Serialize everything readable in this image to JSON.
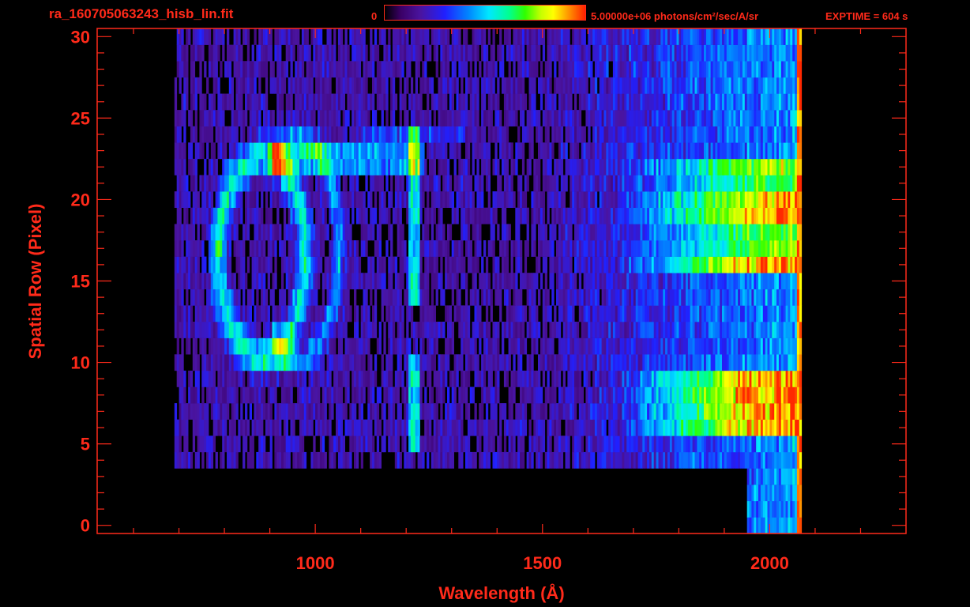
{
  "chart_data": {
    "type": "heatmap",
    "title": "ra_160705063243_hisb_lin.fit",
    "xlabel": "Wavelength (Å)",
    "ylabel": "Spatial Row (Pixel)",
    "xlim": [
      520,
      2300
    ],
    "ylim": [
      -0.5,
      30.5
    ],
    "x_ticks": [
      1000,
      1500,
      2000
    ],
    "y_ticks": [
      0,
      5,
      10,
      15,
      20,
      25,
      30
    ],
    "colorbar": {
      "min_label": "0",
      "max_label": "5.00000e+06 photons/cm²/sec/A/sr",
      "min": 0,
      "max": 5000000
    },
    "exptime_label": "EXPTIME = 604 s",
    "colormap": [
      "#000000",
      "#3a0066",
      "#2020ff",
      "#00e8ff",
      "#30ff00",
      "#ffff00",
      "#ff2000"
    ],
    "axis_color": "#ff2a1a",
    "data_extent": {
      "x_start": 690,
      "x_end": 2070,
      "row_start": 0,
      "row_end": 30
    },
    "features": [
      {
        "name": "loop arc",
        "x": 860,
        "row": 17,
        "level": 0.7
      },
      {
        "name": "vertical line",
        "x": 1215,
        "row": 17,
        "level": 0.45
      },
      {
        "name": "upper band",
        "x": [
          1650,
          2060
        ],
        "rows": [
          16,
          22
        ],
        "level": 0.75
      },
      {
        "name": "lower band",
        "x": [
          1650,
          2060
        ],
        "rows": [
          6,
          9
        ],
        "level": 0.8
      }
    ]
  }
}
